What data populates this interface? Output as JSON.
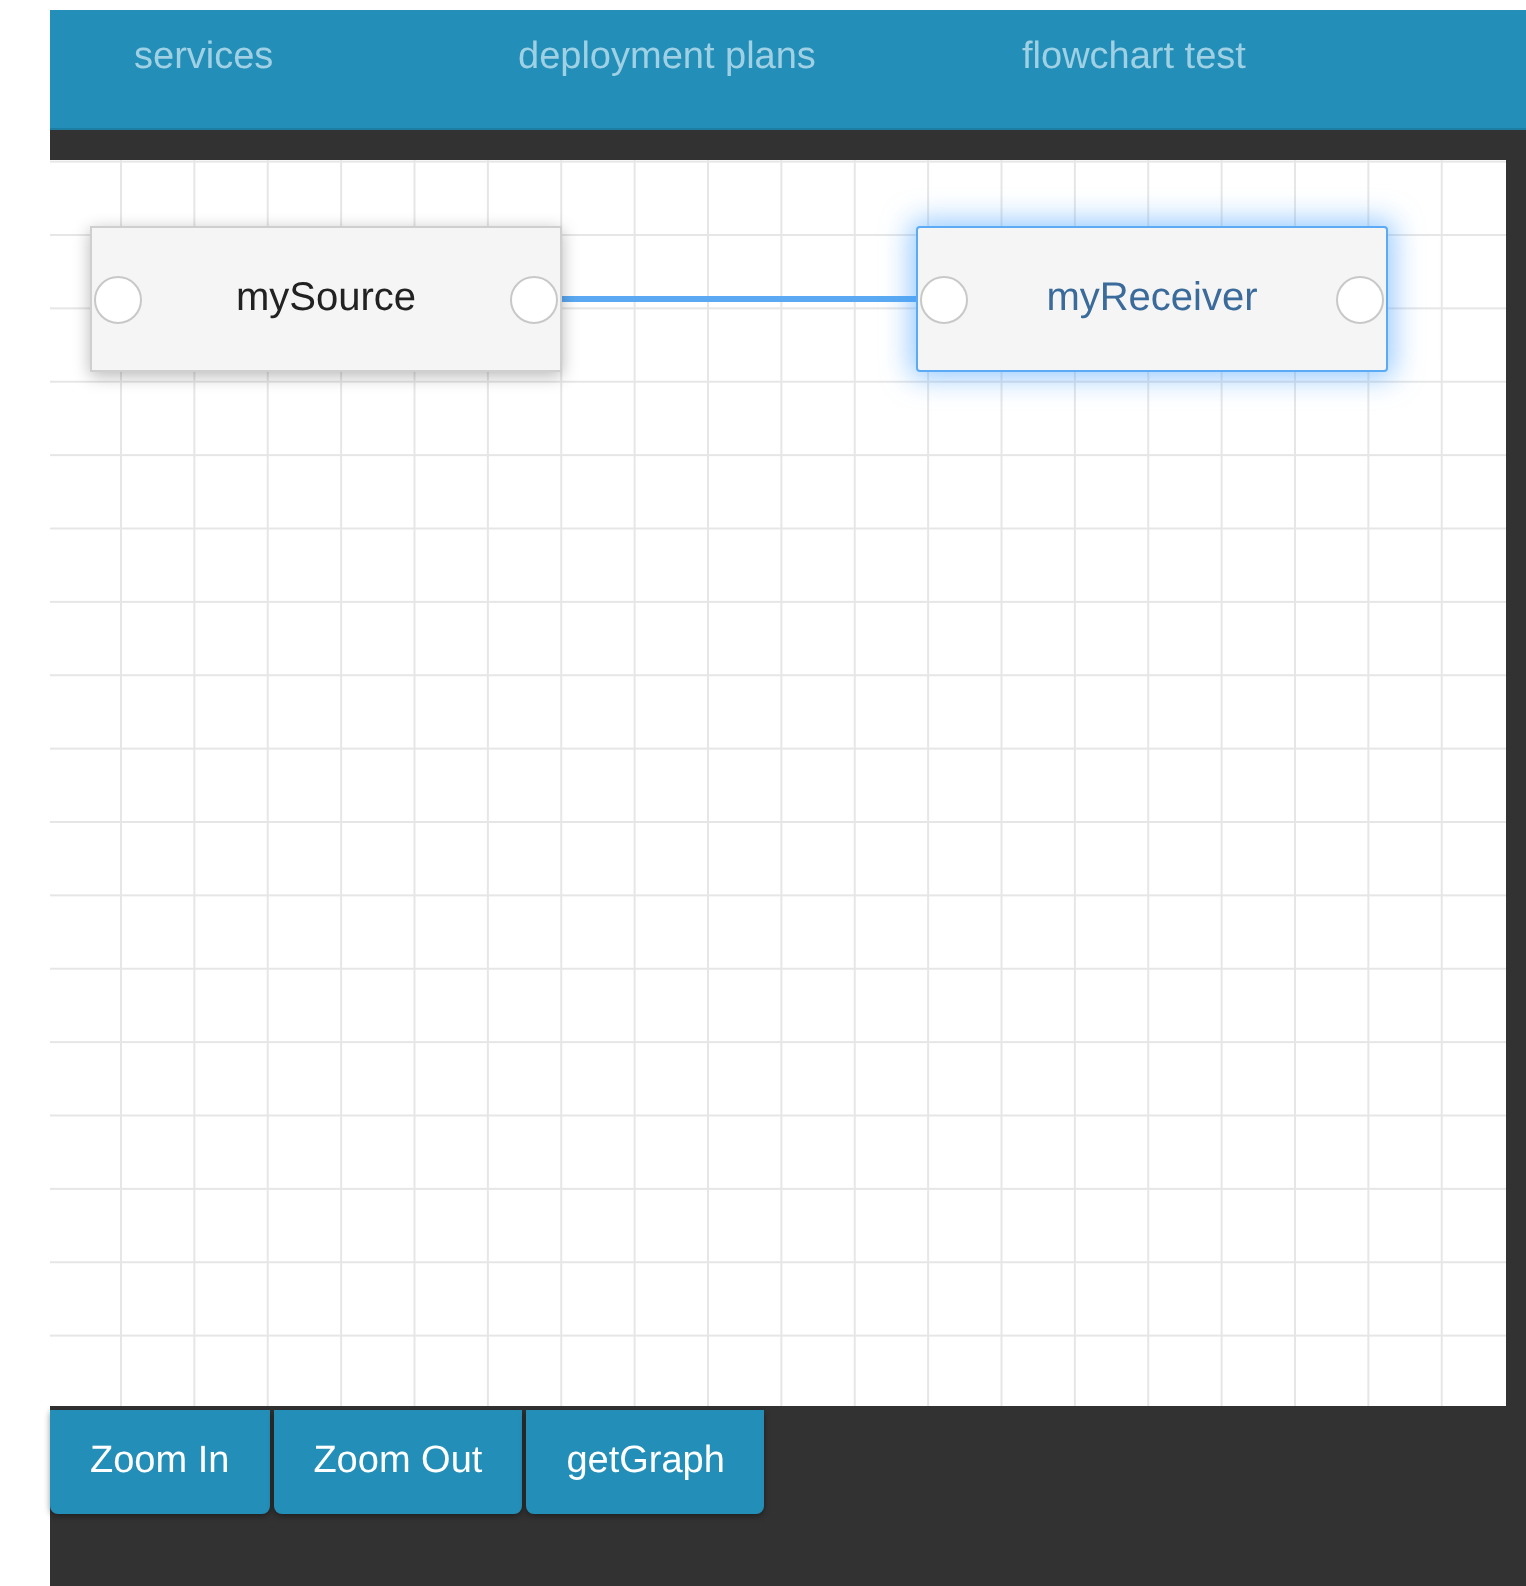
{
  "nav": [
    {
      "label": "services"
    },
    {
      "label": "deployment plans"
    },
    {
      "label": "flowchart test"
    }
  ],
  "flowchart": {
    "nodes": [
      {
        "label": "mySource",
        "selected": false,
        "linked_to_next": true
      },
      {
        "label": "myReceiver",
        "selected": true
      }
    ]
  },
  "buttons": [
    {
      "label": "Zoom In"
    },
    {
      "label": "Zoom Out"
    },
    {
      "label": "getGraph"
    }
  ]
}
